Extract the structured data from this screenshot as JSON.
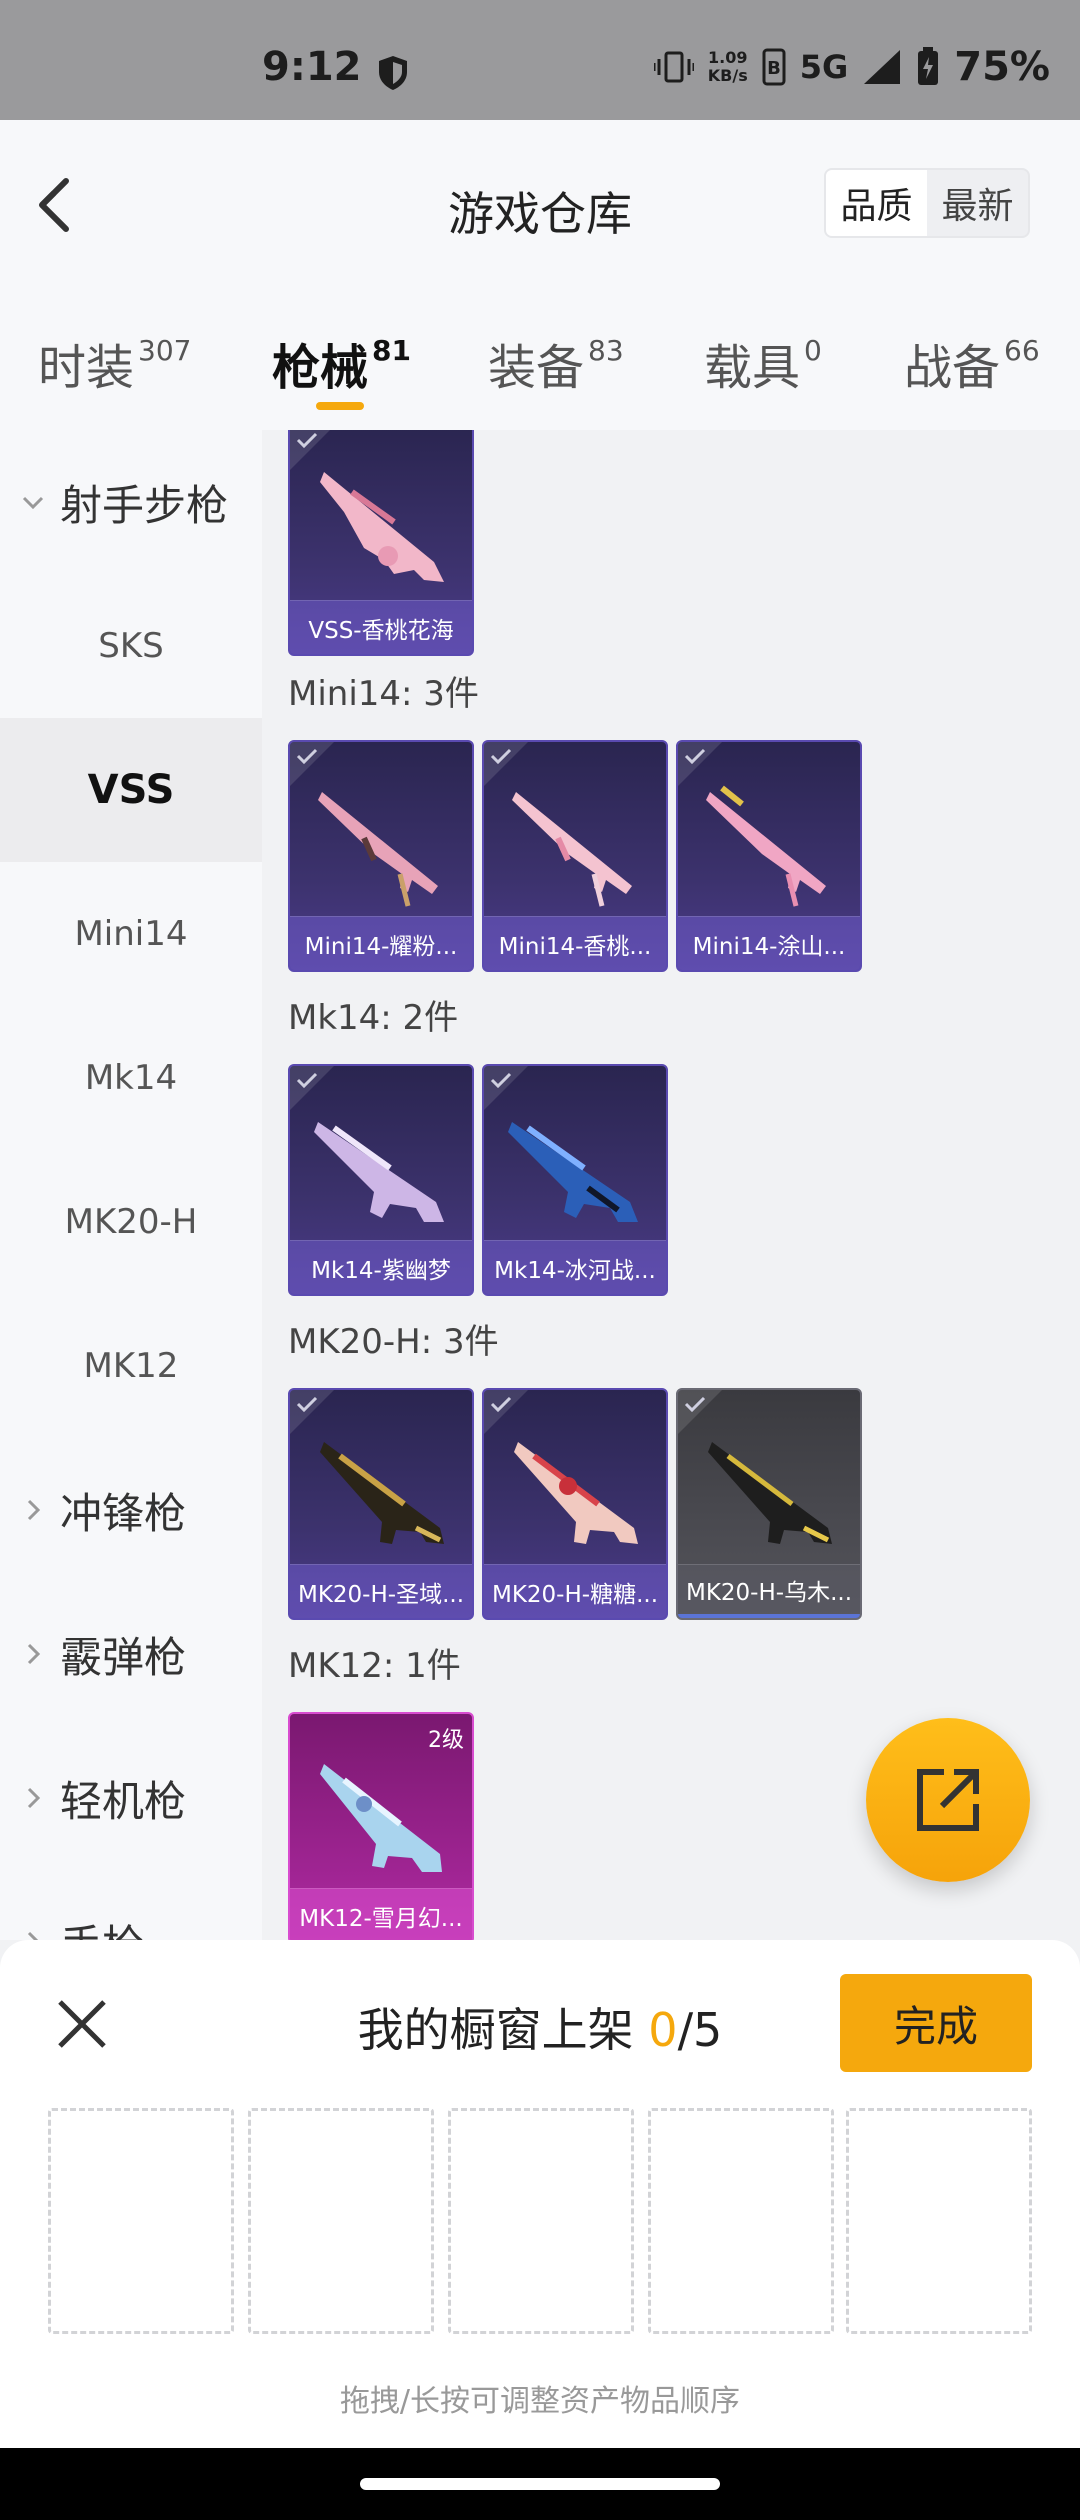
{
  "status_bar": {
    "time": "9:12",
    "net_speed": "1.09",
    "net_unit": "KB/s",
    "network": "5G",
    "battery": "75%"
  },
  "header": {
    "title": "游戏仓库",
    "sort_options": [
      "品质",
      "最新"
    ],
    "sort_selected": "品质"
  },
  "tabs": [
    {
      "label": "时装",
      "count": "307"
    },
    {
      "label": "枪械",
      "count": "81",
      "active": true
    },
    {
      "label": "装备",
      "count": "83"
    },
    {
      "label": "载具",
      "count": "0"
    },
    {
      "label": "战备",
      "count": "66"
    }
  ],
  "sidebar": {
    "expanded_category": "射手步枪",
    "sub_items": [
      "SKS",
      "VSS",
      "Mini14",
      "Mk14",
      "MK20-H",
      "MK12"
    ],
    "selected": "VSS",
    "categories": [
      "冲锋枪",
      "霰弹枪",
      "轻机枪",
      "手枪"
    ]
  },
  "content": {
    "groups": [
      {
        "title": "",
        "items": [
          {
            "name": "VSS-香桃花海",
            "style": "purple"
          }
        ]
      },
      {
        "title": "Mini14: 3件",
        "items": [
          {
            "name": "Mini14-耀粉...",
            "style": "purple"
          },
          {
            "name": "Mini14-香桃...",
            "style": "purple"
          },
          {
            "name": "Mini14-涂山...",
            "style": "purple"
          }
        ]
      },
      {
        "title": "Mk14: 2件",
        "items": [
          {
            "name": "Mk14-紫幽梦",
            "style": "purple"
          },
          {
            "name": "Mk14-冰河战...",
            "style": "purple"
          }
        ]
      },
      {
        "title": "MK20-H: 3件",
        "items": [
          {
            "name": "MK20-H-圣域...",
            "style": "purple"
          },
          {
            "name": "MK20-H-糖糖...",
            "style": "purple"
          },
          {
            "name": "MK20-H-乌木...",
            "style": "grey"
          }
        ]
      },
      {
        "title": "MK12: 1件",
        "items": [
          {
            "name": "MK12-雪月幻...",
            "style": "pink",
            "level": "2级"
          }
        ]
      }
    ]
  },
  "panel": {
    "title": "我的橱窗上架",
    "count_current": "0",
    "count_total": "/5",
    "done_label": "完成",
    "slots": 5,
    "hint": "拖拽/长按可调整资产物品顺序"
  },
  "colors": {
    "accent": "#f5a80d",
    "card_purple": "#3c326d",
    "card_pink": "#b02aa2",
    "card_grey": "#55555c"
  }
}
